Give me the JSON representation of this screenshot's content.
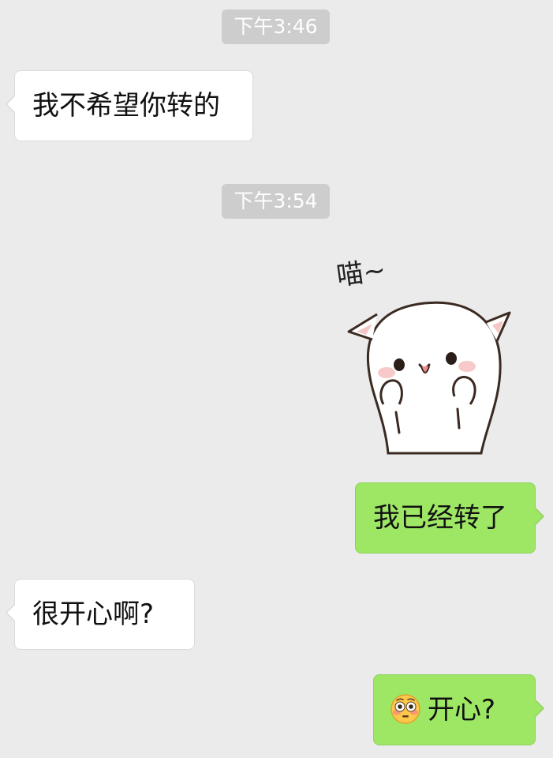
{
  "timestamps": [
    "下午3:46",
    "下午3:54"
  ],
  "messages": {
    "m1": "我不希望你转的",
    "m2": "我已经转了",
    "m3": "很开心啊?",
    "m4": "开心?"
  },
  "sticker": {
    "caption": "喵~",
    "icon": "white-cat-sticker"
  },
  "emoji": {
    "icon": "flushed-face-emoji"
  },
  "colors": {
    "background": "#ebebeb",
    "bubble_incoming": "#ffffff",
    "bubble_outgoing": "#9ee765",
    "timestamp_bg": "#cdcdcd"
  }
}
